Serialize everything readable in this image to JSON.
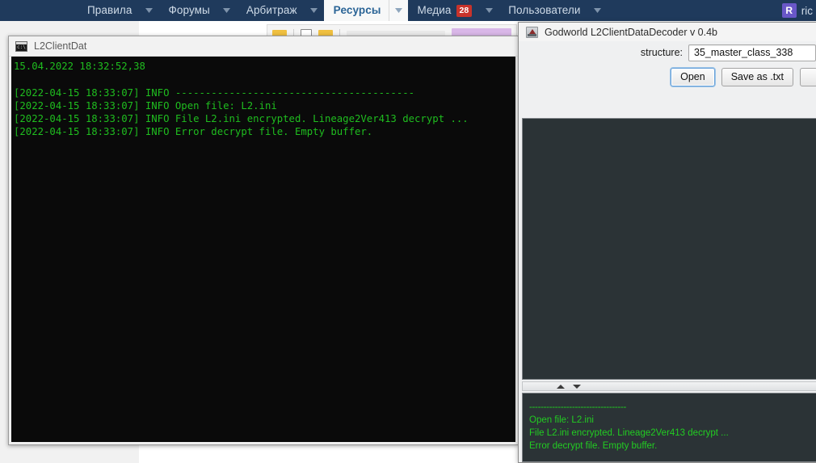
{
  "navbar": {
    "items": [
      {
        "label": "Правила",
        "caret": "chevron-down-icon",
        "active": false,
        "badge": null
      },
      {
        "label": "Форумы",
        "caret": "chevron-down-icon",
        "active": false,
        "badge": null
      },
      {
        "label": "Арбитраж",
        "caret": "chevron-down-icon",
        "active": false,
        "badge": null
      },
      {
        "label": "Ресурсы",
        "caret": "chevron-down-icon",
        "active": true,
        "badge": null
      },
      {
        "label": "Медиа",
        "caret": "chevron-down-icon",
        "active": false,
        "badge": "28"
      },
      {
        "label": "Пользователи",
        "caret": "chevron-down-icon",
        "active": false,
        "badge": null
      }
    ],
    "user": {
      "avatar_initial": "R",
      "name": "ric"
    },
    "colors": {
      "bar_bg": "#1f3a5c",
      "active_bg": "#f7f8f8",
      "active_text": "#2a6496",
      "badge_bg": "#c8332b"
    }
  },
  "console_window": {
    "title": "L2ClientDat",
    "icon": "cmd-console-icon",
    "lines": [
      "15.04.2022 18:32:52,38",
      "",
      "[2022-04-15 18:33:07] INFO ----------------------------------------",
      "[2022-04-15 18:33:07] INFO Open file: L2.ini",
      "[2022-04-15 18:33:07] INFO File L2.ini encrypted. Lineage2Ver413 decrypt ...",
      "[2022-04-15 18:33:07] INFO Error decrypt file. Empty buffer."
    ],
    "text_color": "#1fbd1f",
    "bg_color": "#0a0a0a"
  },
  "decoder_window": {
    "title": "Godworld L2ClientDataDecoder v 0.4b",
    "icon": "app-icon",
    "structure_label": "structure:",
    "structure_value": "35_master_class_338",
    "buttons": [
      {
        "label": "Open",
        "focused": true
      },
      {
        "label": "Save as .txt",
        "focused": false
      },
      {
        "label": "",
        "focused": false
      }
    ],
    "splitter": {
      "up_icon": "triangle-up-icon",
      "down_icon": "triangle-down-icon"
    },
    "grid_bg": "#2b3336",
    "log": {
      "lines": [
        "----------------------------------",
        "Open file: L2.ini",
        "File L2.ini encrypted. Lineage2Ver413 decrypt ...",
        "Error decrypt file. Empty buffer."
      ],
      "text_color": "#22cc22",
      "bg_color": "#2b3336"
    }
  }
}
